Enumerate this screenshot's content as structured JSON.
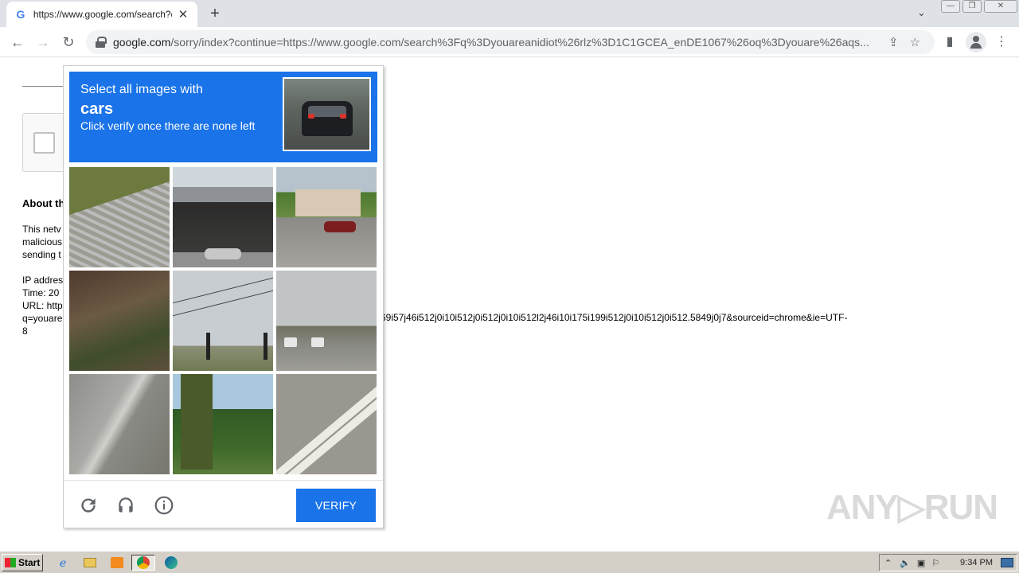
{
  "browser": {
    "tab_favicon": "G",
    "tab_title": "https://www.google.com/search?q=",
    "tab_close": "✕",
    "new_tab": "+",
    "tabs_chevron": "⌄",
    "window_buttons": [
      "—",
      "❐",
      "✕"
    ],
    "back": "←",
    "forward": "→",
    "reload": "↻",
    "url_host": "google.com",
    "url_rest": "/sorry/index?continue=https://www.google.com/search%3Fq%3Dyouareanidiot%26rlz%3D1C1GCEA_enDE1067%26oq%3Dyouare%26aqs...",
    "share_icon": "⇪",
    "star_icon": "☆",
    "side_panel_icon": "▮",
    "menu_icon": "⋮"
  },
  "page": {
    "about_heading": "About th",
    "paragraph_lines": [
      "This netv",
      "malicious",
      "sending t"
    ],
    "ip_line": "IP addres",
    "time_line": "Time: 20",
    "url_line": "URL: http",
    "url_line2": "q=youare",
    "url_line3": "8",
    "url_tail": "69i57j46i512j0i10i512j0i512j0i10i512l2j46i10i175i199i512j0i10i512j0i512.5849j0j7&sourceid=chrome&ie=UTF-"
  },
  "captcha": {
    "instruction_line1": "Select all images with",
    "target": "cars",
    "instruction_line3": "Click verify once there are none left",
    "verify_label": "VERIFY"
  },
  "watermark": "ANY▷RUN",
  "taskbar": {
    "start_label": "Start",
    "clock": "9:34 PM"
  }
}
